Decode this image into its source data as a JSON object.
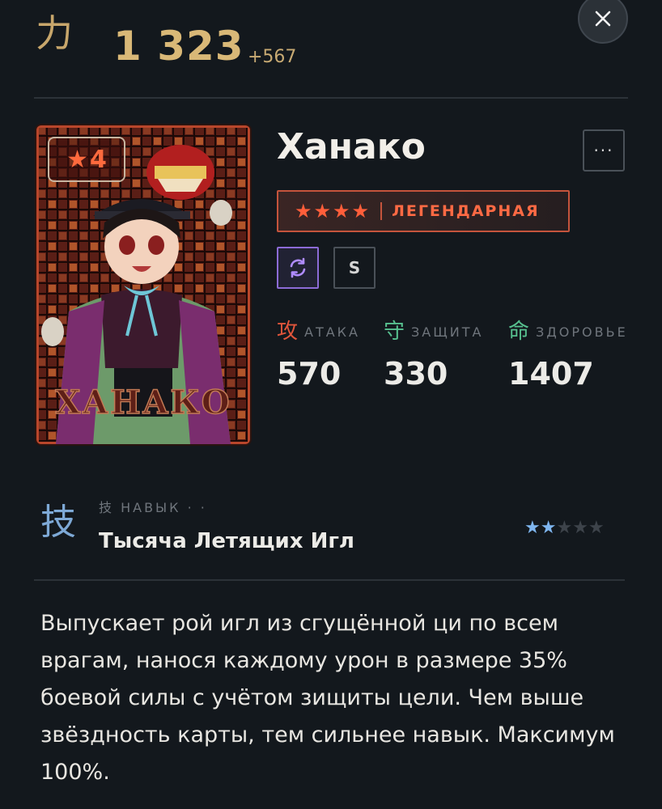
{
  "power": {
    "icon": "power-kanji-icon",
    "glyph": "力",
    "value": "1 323",
    "delta": "+567"
  },
  "card": {
    "star_level": "4",
    "title_art": "ХАНАКО"
  },
  "character": {
    "name": "Ханако",
    "rarity_stars": "★★★★",
    "rarity_label": "ЛЕГЕНДАРНАЯ",
    "tag_s": "S"
  },
  "stats": [
    {
      "glyph": "攻",
      "label": "АТАКА",
      "value": "570",
      "color": "#e0553b"
    },
    {
      "glyph": "守",
      "label": "ЗАЩИТА",
      "value": "330",
      "color": "#57c08f"
    },
    {
      "glyph": "命",
      "label": "ЗДОРОВЬЕ",
      "value": "1407",
      "color": "#57c08f"
    }
  ],
  "skill": {
    "glyph": "技",
    "kind": "技 НАВЫК · ·",
    "name": "Тысяча Летящих Игл",
    "stars_filled": 2,
    "stars_total": 5,
    "description": "Выпускает рой игл из сгущённой ци по всем врагам, нанося каждому урон в размере 35% боевой силы с учётом зищиты цели. Чем выше звёздность карты, тем сильнее навык. Максимум 100%."
  },
  "colors": {
    "accent_gold": "#d9b877",
    "legendary": "#ff5e3a",
    "skill_blue": "#7fb6f0",
    "tag_purple": "#8c6bd6"
  }
}
